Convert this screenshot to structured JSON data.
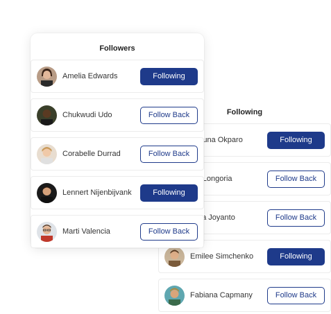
{
  "colors": {
    "accent": "#1e3a8a",
    "panel_bg": "#ffffff",
    "row_border": "#ececec"
  },
  "followers_panel": {
    "title": "Followers",
    "rows": [
      {
        "name": "Amelia Edwards",
        "button": "Following",
        "state": "following"
      },
      {
        "name": "Chukwudi Udo",
        "button": "Follow Back",
        "state": "follow-back"
      },
      {
        "name": "Corabelle Durrad",
        "button": "Follow Back",
        "state": "follow-back"
      },
      {
        "name": "Lennert Nijenbijvank",
        "button": "Following",
        "state": "following"
      },
      {
        "name": "Marti Valencia",
        "button": "Follow Back",
        "state": "follow-back"
      }
    ]
  },
  "following_panel": {
    "title": "Following",
    "rows": [
      {
        "name": "Kamsi Chimefuna Okparo",
        "visible_name": "mefuna Okparo",
        "button": "Following",
        "state": "following"
      },
      {
        "name": "Ela Longoria",
        "visible_name": "ela Longoria",
        "button": "Follow Back",
        "state": "follow-back"
      },
      {
        "name": "Krikrika Joyanto",
        "visible_name": "krika Joyanto",
        "button": "Follow Back",
        "state": "follow-back"
      },
      {
        "name": "Emilee Simchenko",
        "visible_name": "Emilee Simchenko",
        "button": "Following",
        "state": "following"
      },
      {
        "name": "Fabiana Capmany",
        "visible_name": "Fabiana Capmany",
        "button": "Follow Back",
        "state": "follow-back"
      }
    ]
  }
}
